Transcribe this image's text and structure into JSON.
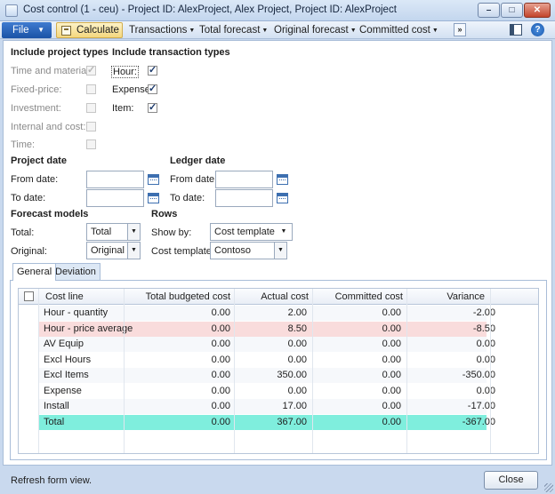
{
  "window": {
    "title": "Cost control (1 - ceu) - Project ID: AlexProject, Alex Project, Project ID: AlexProject"
  },
  "actions": {
    "file": "File",
    "calculate": "Calculate",
    "transactions": "Transactions",
    "total_forecast": "Total forecast",
    "original_forecast": "Original forecast",
    "committed_cost": "Committed cost",
    "more": "»"
  },
  "project_types": {
    "heading": "Include project types",
    "items": [
      {
        "label": "Time and material:",
        "checked": true
      },
      {
        "label": "Fixed-price:",
        "checked": false
      },
      {
        "label": "Investment:",
        "checked": false
      },
      {
        "label": "Internal and cost:",
        "checked": false
      },
      {
        "label": "Time:",
        "checked": false
      }
    ]
  },
  "transaction_types": {
    "heading": "Include transaction types",
    "items": [
      {
        "label": "Hour:",
        "checked": true
      },
      {
        "label": "Expense:",
        "checked": true
      },
      {
        "label": "Item:",
        "checked": true
      }
    ]
  },
  "project_date": {
    "heading": "Project date",
    "from_label": "From date:",
    "to_label": "To date:",
    "from_value": "",
    "to_value": ""
  },
  "ledger_date": {
    "heading": "Ledger date",
    "from_label": "From date:",
    "to_label": "To date:",
    "from_value": "",
    "to_value": ""
  },
  "forecast_models": {
    "heading": "Forecast models",
    "total_label": "Total:",
    "total_value": "Total",
    "original_label": "Original:",
    "original_value": "Original"
  },
  "rows_group": {
    "heading": "Rows",
    "show_by_label": "Show by:",
    "show_by_value": "Cost template",
    "template_label": "Cost template:",
    "template_value": "Contoso"
  },
  "tabs": [
    "General",
    "Deviation"
  ],
  "grid": {
    "columns": [
      "Cost line",
      "Total budgeted cost",
      "Actual cost",
      "Committed cost",
      "Variance"
    ],
    "rows": [
      [
        "Hour - quantity",
        "0.00",
        "2.00",
        "0.00",
        "-2.00"
      ],
      [
        "Hour - price average",
        "0.00",
        "8.50",
        "0.00",
        "-8.50"
      ],
      [
        "AV Equip",
        "0.00",
        "0.00",
        "0.00",
        "0.00"
      ],
      [
        "Excl Hours",
        "0.00",
        "0.00",
        "0.00",
        "0.00"
      ],
      [
        "Excl Items",
        "0.00",
        "350.00",
        "0.00",
        "-350.00"
      ],
      [
        "Expense",
        "0.00",
        "0.00",
        "0.00",
        "0.00"
      ],
      [
        "Install",
        "0.00",
        "17.00",
        "0.00",
        "-17.00"
      ],
      [
        "Total",
        "0.00",
        "367.00",
        "0.00",
        "-367.00"
      ]
    ],
    "selected_row": 1,
    "total_row": 7,
    "colors": {
      "selected": "#f9dcdc",
      "total": "#7feedd"
    }
  },
  "status": {
    "text": "Refresh form view.",
    "close": "Close"
  }
}
